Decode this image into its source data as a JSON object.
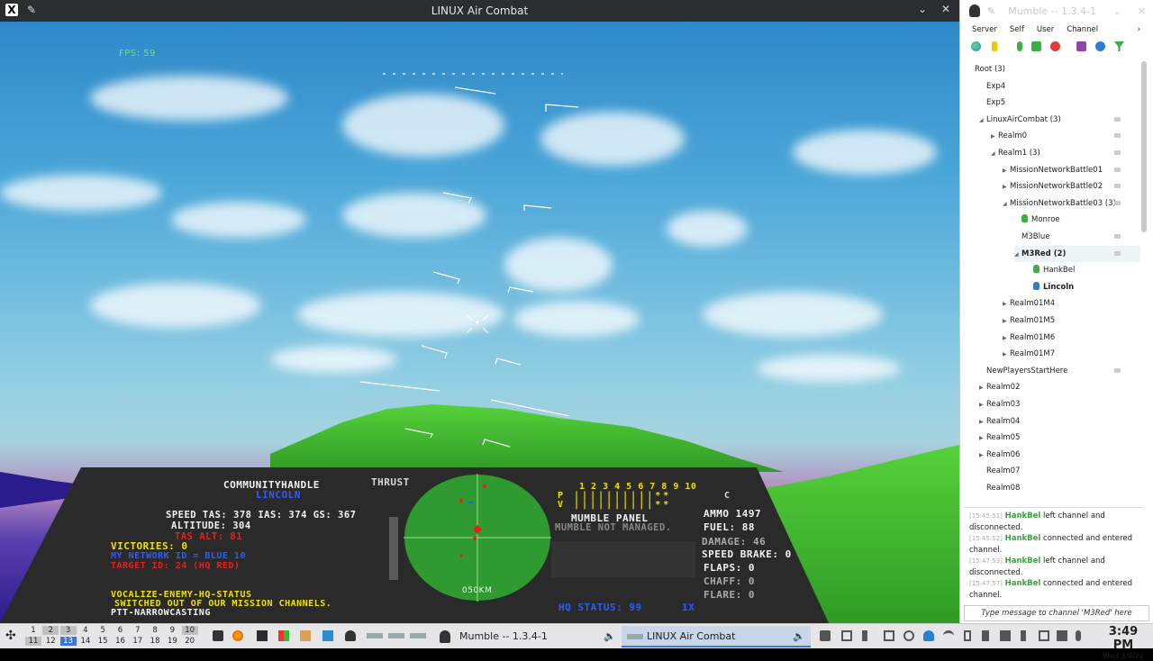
{
  "game": {
    "title": "LINUX Air Combat",
    "fps": "FPS: 59",
    "handle_label": "COMMUNITYHANDLE",
    "handle": "LINCOLN",
    "thrust": "THRUST",
    "speed_line": "SPEED   TAS: 378  IAS: 374  GS: 367",
    "altitude_line": "ALTITUDE:  304",
    "tas_alt_line": "TAS ALT:   81",
    "victories": "VICTORIES: 0",
    "network_id": "MY NETWORK ID = BLUE 10",
    "target": "TARGET ID: 24 (HQ RED)",
    "vocalize": "VOCALIZE-ENEMY-HQ-STATUS",
    "switched": "SWITCHED OUT OF OUR MISSION CHANNELS.",
    "ptt": "PTT-NARROWCASTING",
    "radar_range": "050KM",
    "numbers": "1 2 3 4 5 6 7 8 9 10",
    "p_row": "P ||||||||||**",
    "v_row": "V ||||||||||**",
    "c_label": "C",
    "mumble_panel": "MUMBLE PANEL",
    "mumble_not_managed": "MUMBLE NOT MANAGED.",
    "ammo": "AMMO 1497",
    "fuel": "FUEL:   88",
    "damage": "DAMAGE:   46",
    "speed_brake": "SPEED BRAKE: 0",
    "flaps": "FLAPS:  0",
    "chaff": "CHAFF:  0",
    "flare": "FLARE:  0",
    "hq_status": "HQ STATUS:   99",
    "hq_x": "1X"
  },
  "mumble": {
    "title": "Mumble -- 1.3.4-1",
    "menu": [
      "Server",
      "Self",
      "User",
      "Channel"
    ],
    "tree": [
      {
        "label": "Root (3)",
        "indent": 0,
        "arrow": "",
        "chat": false
      },
      {
        "label": "Exp4",
        "indent": 1,
        "arrow": "",
        "chat": false
      },
      {
        "label": "Exp5",
        "indent": 1,
        "arrow": "",
        "chat": false
      },
      {
        "label": "LinuxAirCombat (3)",
        "indent": 1,
        "arrow": "down",
        "chat": true
      },
      {
        "label": "Realm0",
        "indent": 2,
        "arrow": "right",
        "chat": true
      },
      {
        "label": "Realm1 (3)",
        "indent": 2,
        "arrow": "down",
        "chat": true
      },
      {
        "label": "MissionNetworkBattle01",
        "indent": 3,
        "arrow": "right",
        "chat": true
      },
      {
        "label": "MissionNetworkBattle02",
        "indent": 3,
        "arrow": "right",
        "chat": true
      },
      {
        "label": "MissionNetworkBattle03 (3)",
        "indent": 3,
        "arrow": "down",
        "chat": true
      },
      {
        "label": "Monroe",
        "indent": 4,
        "arrow": "",
        "user": "green",
        "chat": false
      },
      {
        "label": "M3Blue",
        "indent": 4,
        "arrow": "",
        "chat": true
      },
      {
        "label": "M3Red (2)",
        "indent": 4,
        "arrow": "down",
        "chat": true,
        "selected": true
      },
      {
        "label": "HankBel",
        "indent": 5,
        "arrow": "",
        "user": "green",
        "chat": false
      },
      {
        "label": "Lincoln",
        "indent": 5,
        "arrow": "",
        "user": "blue",
        "chat": false,
        "bold": true
      },
      {
        "label": "Realm01M4",
        "indent": 3,
        "arrow": "right",
        "chat": false
      },
      {
        "label": "Realm01M5",
        "indent": 3,
        "arrow": "right",
        "chat": false
      },
      {
        "label": "Realm01M6",
        "indent": 3,
        "arrow": "right",
        "chat": false
      },
      {
        "label": "Realm01M7",
        "indent": 3,
        "arrow": "right",
        "chat": false
      },
      {
        "label": "NewPlayersStartHere",
        "indent": 1,
        "arrow": "",
        "chat": true
      },
      {
        "label": "Realm02",
        "indent": 1,
        "arrow": "right",
        "chat": false
      },
      {
        "label": "Realm03",
        "indent": 1,
        "arrow": "right",
        "chat": false
      },
      {
        "label": "Realm04",
        "indent": 1,
        "arrow": "right",
        "chat": false
      },
      {
        "label": "Realm05",
        "indent": 1,
        "arrow": "right",
        "chat": false
      },
      {
        "label": "Realm06",
        "indent": 1,
        "arrow": "right",
        "chat": false
      },
      {
        "label": "Realm07",
        "indent": 1,
        "arrow": "",
        "chat": false
      },
      {
        "label": "Realm08",
        "indent": 1,
        "arrow": "",
        "chat": false
      }
    ],
    "chat": [
      {
        "ts": "[15:45:51]",
        "name": "HankBel",
        "msg": " left channel and disconnected."
      },
      {
        "ts": "[15:45:52]",
        "name": "HankBel",
        "msg": " connected and entered channel."
      },
      {
        "ts": "[15:47:53]",
        "name": "HankBel",
        "msg": " left channel and disconnected."
      },
      {
        "ts": "[15:47:57]",
        "name": "HankBel",
        "msg": " connected and entered channel."
      }
    ],
    "input_placeholder": "Type message to channel 'M3Red' here"
  },
  "taskbar": {
    "ws_top": [
      "1",
      "2",
      "3",
      "4",
      "5",
      "6",
      "7",
      "8",
      "9",
      "10"
    ],
    "ws_bottom": [
      "11",
      "12",
      "13",
      "14",
      "15",
      "16",
      "17",
      "18",
      "19",
      "20"
    ],
    "task_mumble": "Mumble -- 1.3.4-1",
    "task_game": "LINUX Air Combat",
    "time": "3:49 PM",
    "date": "Wed 3/9/22"
  },
  "colors": {
    "hud_white": "#f2f2f2",
    "hud_yellow": "#f0e000",
    "hud_red": "#e8201a",
    "hud_blue": "#2a5cff",
    "hud_green": "#7ee05a",
    "radar": "#2f9a2f"
  }
}
